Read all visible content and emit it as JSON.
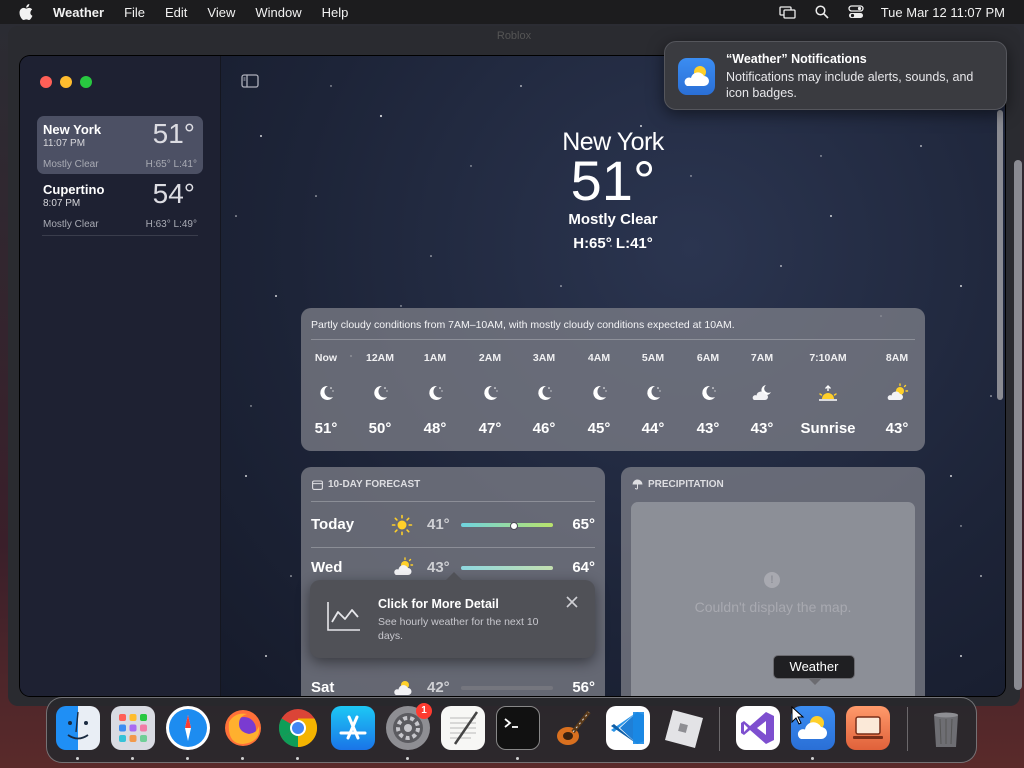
{
  "menubar": {
    "app_name": "Weather",
    "items": [
      "File",
      "Edit",
      "View",
      "Window",
      "Help"
    ],
    "clock": "Tue Mar 12  11:07 PM"
  },
  "background_window_title": "Roblox",
  "sidebar": {
    "locations": [
      {
        "city": "New York",
        "time": "11:07 PM",
        "condition": "Mostly Clear",
        "temp": "51°",
        "hl": "H:65°  L:41°",
        "selected": true
      },
      {
        "city": "Cupertino",
        "time": "8:07 PM",
        "condition": "Mostly Clear",
        "temp": "54°",
        "hl": "H:63°  L:49°",
        "selected": false
      }
    ]
  },
  "hero": {
    "city": "New York",
    "temp": "51°",
    "condition": "Mostly Clear",
    "hl": "H:65°  L:41°"
  },
  "hourly": {
    "summary": "Partly cloudy conditions from 7AM–10AM, with mostly cloudy conditions expected at 10AM.",
    "items": [
      {
        "label": "Now",
        "icon": "moon-icon",
        "value": "51°"
      },
      {
        "label": "12AM",
        "icon": "moon-icon",
        "value": "50°"
      },
      {
        "label": "1AM",
        "icon": "moon-icon",
        "value": "48°"
      },
      {
        "label": "2AM",
        "icon": "moon-icon",
        "value": "47°"
      },
      {
        "label": "3AM",
        "icon": "moon-icon",
        "value": "46°"
      },
      {
        "label": "4AM",
        "icon": "moon-icon",
        "value": "45°"
      },
      {
        "label": "5AM",
        "icon": "moon-icon",
        "value": "44°"
      },
      {
        "label": "6AM",
        "icon": "moon-icon",
        "value": "43°"
      },
      {
        "label": "7AM",
        "icon": "cloud-moon-icon",
        "value": "43°"
      },
      {
        "label": "7:10AM",
        "icon": "sunrise-icon",
        "value": "Sunrise"
      },
      {
        "label": "8AM",
        "icon": "cloud-sun-icon",
        "value": "43°"
      }
    ]
  },
  "forecast": {
    "header": "10-DAY FORECAST",
    "rows": [
      {
        "day": "Today",
        "icon": "sun-icon",
        "low": "41°",
        "high": "65°"
      },
      {
        "day": "Wed",
        "icon": "cloud-sun-icon",
        "low": "43°",
        "high": "64°"
      },
      {
        "day": "Sat",
        "icon": "cloud-sun-icon",
        "low": "42°",
        "high": "56°"
      }
    ]
  },
  "precipitation": {
    "header": "PRECIPITATION",
    "message": "Couldn't display the map."
  },
  "popup": {
    "title": "Click for More Detail",
    "body": "See hourly weather for the next 10 days."
  },
  "notification": {
    "title": "“Weather” Notifications",
    "body": "Notifications may include alerts, sounds, and icon badges."
  },
  "dock": {
    "tooltip": "Weather",
    "apps": [
      "Finder",
      "Launchpad",
      "Safari",
      "Firefox",
      "Chrome",
      "App Store",
      "System Settings",
      "TextEdit",
      "Terminal",
      "GarageBand",
      "Visual Studio Code",
      "Roblox",
      "Visual Studio",
      "Weather",
      "Screen Sharing",
      "Trash"
    ],
    "settings_badge": "1"
  },
  "colors": {
    "accent": "#3b8df2",
    "sidebar_selected": "#4c5064",
    "card": "#82848c"
  }
}
